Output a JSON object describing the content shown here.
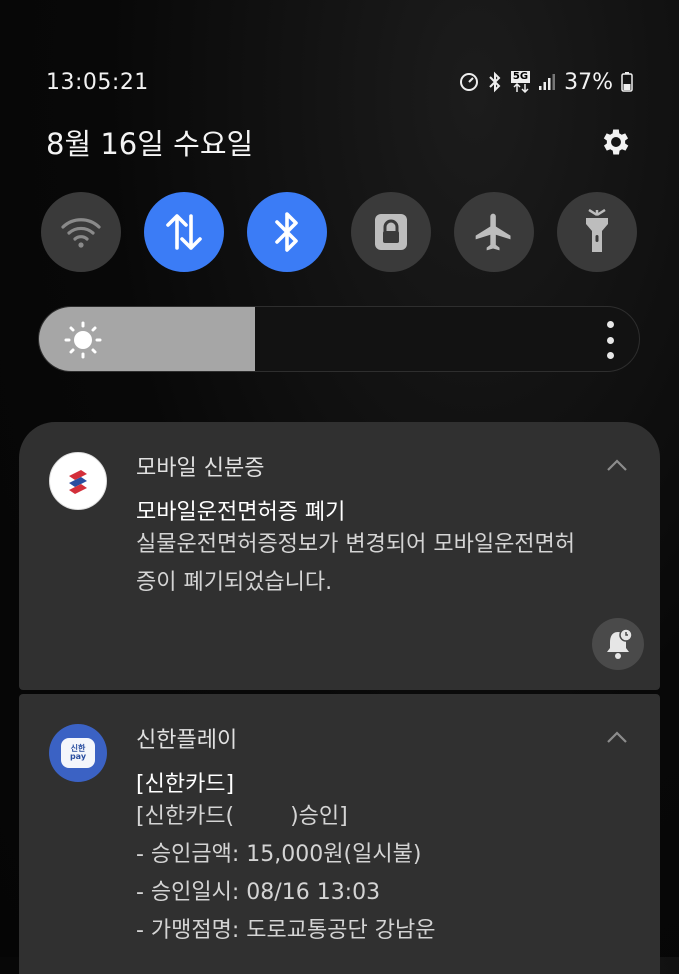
{
  "status_bar": {
    "time": "13:05:21",
    "network": "5G",
    "battery": "37%",
    "icons": [
      "speedometer-icon",
      "bluetooth-icon",
      "5g-data-icon",
      "signal-icon",
      "battery-icon"
    ]
  },
  "header": {
    "date": "8월 16일 수요일",
    "settings_icon": "gear-icon"
  },
  "quick_toggles": [
    {
      "name": "wifi",
      "icon": "wifi-icon",
      "on": false
    },
    {
      "name": "mobile-data",
      "icon": "data-arrows-icon",
      "on": true
    },
    {
      "name": "bluetooth",
      "icon": "bluetooth-icon",
      "on": true
    },
    {
      "name": "rotation-lock",
      "icon": "lock-icon",
      "on": false
    },
    {
      "name": "airplane-mode",
      "icon": "airplane-icon",
      "on": false
    },
    {
      "name": "flashlight",
      "icon": "flashlight-icon",
      "on": false
    }
  ],
  "brightness": {
    "level": 0.36,
    "icon": "sun-icon"
  },
  "colors": {
    "accent": "#3b7cf6",
    "card": "#303030",
    "toggle_off": "#3a3a3a"
  },
  "notifications": [
    {
      "app": "모바일 신분증",
      "title": "모바일운전면허증 폐기",
      "body_lines": [
        "실물운전면허증정보가 변경되어 모바일운전면허",
        "증이 폐기되었습니다."
      ]
    },
    {
      "app": "신한플레이",
      "icon_text": "신한 pay",
      "title": "[신한카드]",
      "body_lines": [
        "[신한카드(        )승인]",
        "- 승인금액: 15,000원(일시불)",
        "- 승인일시: 08/16 13:03",
        "- 가맹점명: 도로교통공단 강남운"
      ]
    }
  ]
}
